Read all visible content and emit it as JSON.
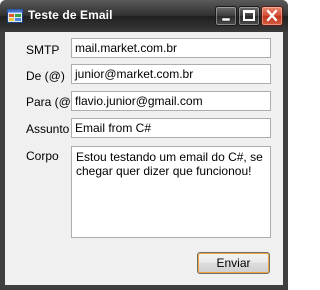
{
  "window": {
    "title": "Teste de Email"
  },
  "icons": {
    "app": "app-window-icon",
    "minimize": "minimize-icon",
    "maximize": "maximize-icon",
    "close": "close-icon"
  },
  "colors": {
    "title_bar": "#2f2f2f",
    "close_button": "#d1492e",
    "client_bg": "#f0f0f0",
    "default_button_focus": "#f0a03c"
  },
  "form": {
    "smtp_label": "SMTP",
    "smtp_value": "mail.market.com.br",
    "from_label": "De (@)",
    "from_value": "junior@market.com.br",
    "to_label": "Para (@)",
    "to_value": "flavio.junior@gmail.com",
    "subject_label": "Assunto",
    "subject_value": "Email from C#",
    "body_label": "Corpo",
    "body_value": "Estou testando um email do C#, se chegar quer dizer que funcionou!",
    "send_label": "Enviar"
  }
}
